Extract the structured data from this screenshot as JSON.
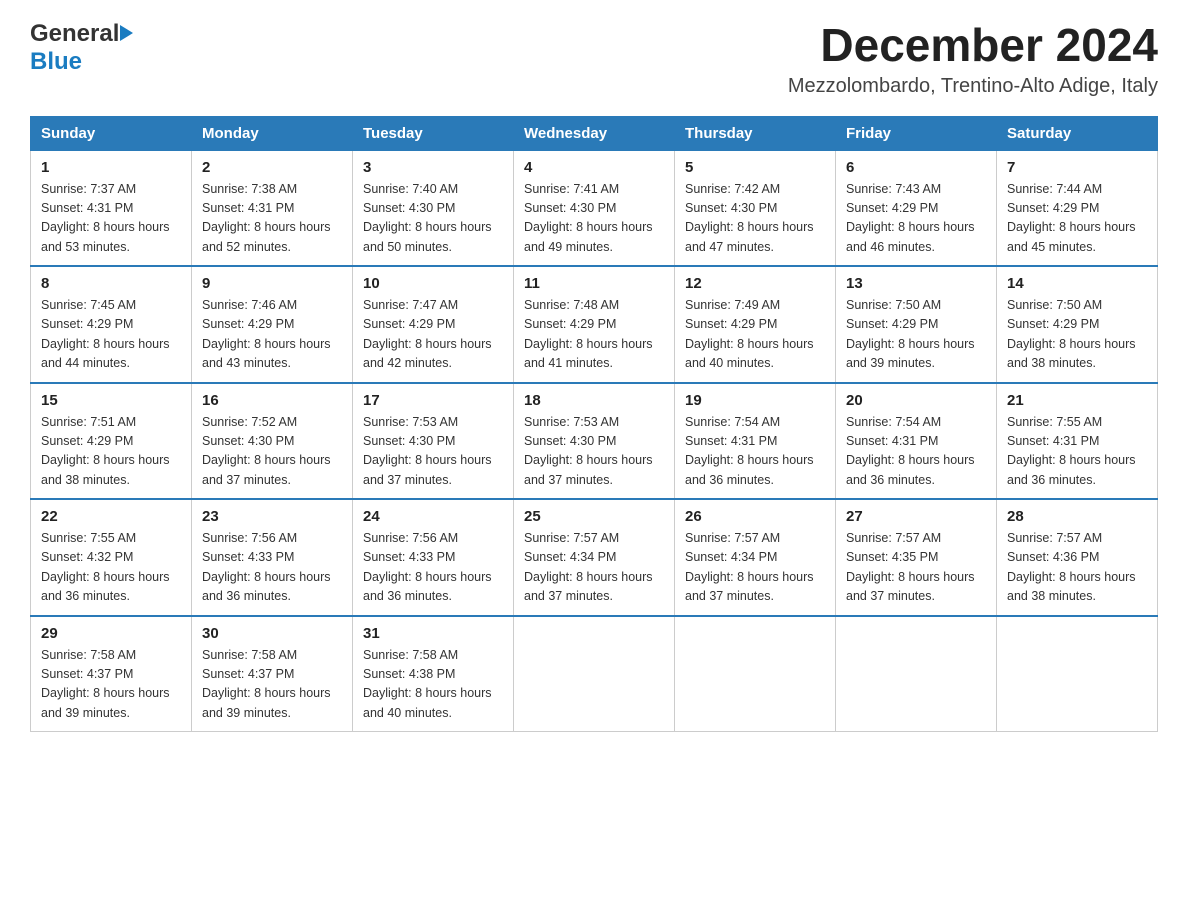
{
  "logo": {
    "line1": "General",
    "line2": "Blue"
  },
  "title": "December 2024",
  "location": "Mezzolombardo, Trentino-Alto Adige, Italy",
  "weekdays": [
    "Sunday",
    "Monday",
    "Tuesday",
    "Wednesday",
    "Thursday",
    "Friday",
    "Saturday"
  ],
  "weeks": [
    [
      {
        "day": "1",
        "sunrise": "7:37 AM",
        "sunset": "4:31 PM",
        "daylight": "8 hours and 53 minutes."
      },
      {
        "day": "2",
        "sunrise": "7:38 AM",
        "sunset": "4:31 PM",
        "daylight": "8 hours and 52 minutes."
      },
      {
        "day": "3",
        "sunrise": "7:40 AM",
        "sunset": "4:30 PM",
        "daylight": "8 hours and 50 minutes."
      },
      {
        "day": "4",
        "sunrise": "7:41 AM",
        "sunset": "4:30 PM",
        "daylight": "8 hours and 49 minutes."
      },
      {
        "day": "5",
        "sunrise": "7:42 AM",
        "sunset": "4:30 PM",
        "daylight": "8 hours and 47 minutes."
      },
      {
        "day": "6",
        "sunrise": "7:43 AM",
        "sunset": "4:29 PM",
        "daylight": "8 hours and 46 minutes."
      },
      {
        "day": "7",
        "sunrise": "7:44 AM",
        "sunset": "4:29 PM",
        "daylight": "8 hours and 45 minutes."
      }
    ],
    [
      {
        "day": "8",
        "sunrise": "7:45 AM",
        "sunset": "4:29 PM",
        "daylight": "8 hours and 44 minutes."
      },
      {
        "day": "9",
        "sunrise": "7:46 AM",
        "sunset": "4:29 PM",
        "daylight": "8 hours and 43 minutes."
      },
      {
        "day": "10",
        "sunrise": "7:47 AM",
        "sunset": "4:29 PM",
        "daylight": "8 hours and 42 minutes."
      },
      {
        "day": "11",
        "sunrise": "7:48 AM",
        "sunset": "4:29 PM",
        "daylight": "8 hours and 41 minutes."
      },
      {
        "day": "12",
        "sunrise": "7:49 AM",
        "sunset": "4:29 PM",
        "daylight": "8 hours and 40 minutes."
      },
      {
        "day": "13",
        "sunrise": "7:50 AM",
        "sunset": "4:29 PM",
        "daylight": "8 hours and 39 minutes."
      },
      {
        "day": "14",
        "sunrise": "7:50 AM",
        "sunset": "4:29 PM",
        "daylight": "8 hours and 38 minutes."
      }
    ],
    [
      {
        "day": "15",
        "sunrise": "7:51 AM",
        "sunset": "4:29 PM",
        "daylight": "8 hours and 38 minutes."
      },
      {
        "day": "16",
        "sunrise": "7:52 AM",
        "sunset": "4:30 PM",
        "daylight": "8 hours and 37 minutes."
      },
      {
        "day": "17",
        "sunrise": "7:53 AM",
        "sunset": "4:30 PM",
        "daylight": "8 hours and 37 minutes."
      },
      {
        "day": "18",
        "sunrise": "7:53 AM",
        "sunset": "4:30 PM",
        "daylight": "8 hours and 37 minutes."
      },
      {
        "day": "19",
        "sunrise": "7:54 AM",
        "sunset": "4:31 PM",
        "daylight": "8 hours and 36 minutes."
      },
      {
        "day": "20",
        "sunrise": "7:54 AM",
        "sunset": "4:31 PM",
        "daylight": "8 hours and 36 minutes."
      },
      {
        "day": "21",
        "sunrise": "7:55 AM",
        "sunset": "4:31 PM",
        "daylight": "8 hours and 36 minutes."
      }
    ],
    [
      {
        "day": "22",
        "sunrise": "7:55 AM",
        "sunset": "4:32 PM",
        "daylight": "8 hours and 36 minutes."
      },
      {
        "day": "23",
        "sunrise": "7:56 AM",
        "sunset": "4:33 PM",
        "daylight": "8 hours and 36 minutes."
      },
      {
        "day": "24",
        "sunrise": "7:56 AM",
        "sunset": "4:33 PM",
        "daylight": "8 hours and 36 minutes."
      },
      {
        "day": "25",
        "sunrise": "7:57 AM",
        "sunset": "4:34 PM",
        "daylight": "8 hours and 37 minutes."
      },
      {
        "day": "26",
        "sunrise": "7:57 AM",
        "sunset": "4:34 PM",
        "daylight": "8 hours and 37 minutes."
      },
      {
        "day": "27",
        "sunrise": "7:57 AM",
        "sunset": "4:35 PM",
        "daylight": "8 hours and 37 minutes."
      },
      {
        "day": "28",
        "sunrise": "7:57 AM",
        "sunset": "4:36 PM",
        "daylight": "8 hours and 38 minutes."
      }
    ],
    [
      {
        "day": "29",
        "sunrise": "7:58 AM",
        "sunset": "4:37 PM",
        "daylight": "8 hours and 39 minutes."
      },
      {
        "day": "30",
        "sunrise": "7:58 AM",
        "sunset": "4:37 PM",
        "daylight": "8 hours and 39 minutes."
      },
      {
        "day": "31",
        "sunrise": "7:58 AM",
        "sunset": "4:38 PM",
        "daylight": "8 hours and 40 minutes."
      },
      null,
      null,
      null,
      null
    ]
  ]
}
